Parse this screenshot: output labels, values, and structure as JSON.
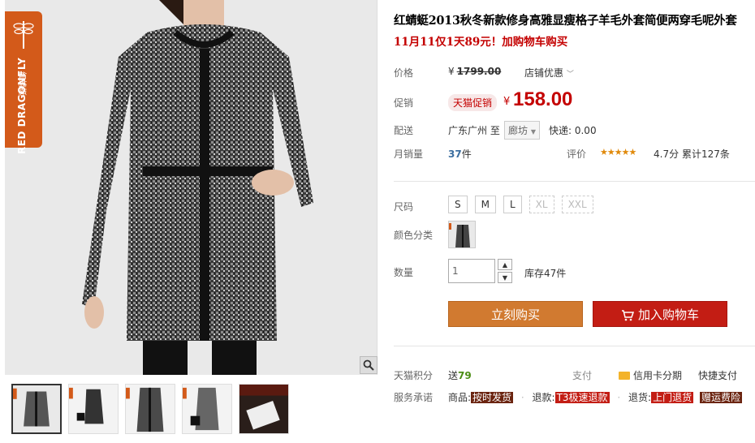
{
  "brand": {
    "name_en": "RED DRAGONFLY",
    "name_cn": "红蜻蜓"
  },
  "product": {
    "title": "红蜻蜓2013秋冬新款修身高雅显瘦格子羊毛外套简便两穿毛呢外套",
    "subtitle": "11月11仅1天89元！加购物车购买"
  },
  "price": {
    "label": "价格",
    "currency": "¥",
    "original": "1799.00",
    "store_discount": "店铺优惠"
  },
  "promo": {
    "label": "促销",
    "badge": "天猫促销",
    "currency": "¥",
    "price": "158.00"
  },
  "shipping": {
    "label": "配送",
    "from": "广东广州 至",
    "dest": "廊坊",
    "fee": "快递: 0.00"
  },
  "sales": {
    "label": "月销量",
    "count": "37",
    "unit": "件",
    "eval_label": "评价",
    "stars": "★★★★★",
    "rating": "4.7分",
    "total": "累计127条"
  },
  "options": {
    "size_label": "尺码",
    "sizes": [
      "S",
      "M",
      "L",
      "XL",
      "XXL"
    ],
    "color_label": "颜色分类",
    "qty_label": "数量",
    "qty_value": "1",
    "stock": "库存47件"
  },
  "actions": {
    "buy_now": "立刻购买",
    "add_cart": "加入购物车"
  },
  "services": {
    "points_label": "天猫积分",
    "points_prefix": "送",
    "points_value": "79",
    "pay_label": "支付",
    "credit": "信用卡分期",
    "quick_pay": "快捷支付",
    "promise_label": "服务承诺",
    "goods_label": "商品:",
    "goods_tag": "按时发货",
    "refund_label": "退款:",
    "refund_tag": "T3极速退款",
    "return_label": "退货:",
    "return_tag": "上门退货",
    "shipping_tag": "赠运费险"
  },
  "colors": {
    "accent_red": "#c40000",
    "buy_orange": "#d17a30",
    "cart_red": "#c31d14",
    "brand_orange": "#d35a1a"
  }
}
